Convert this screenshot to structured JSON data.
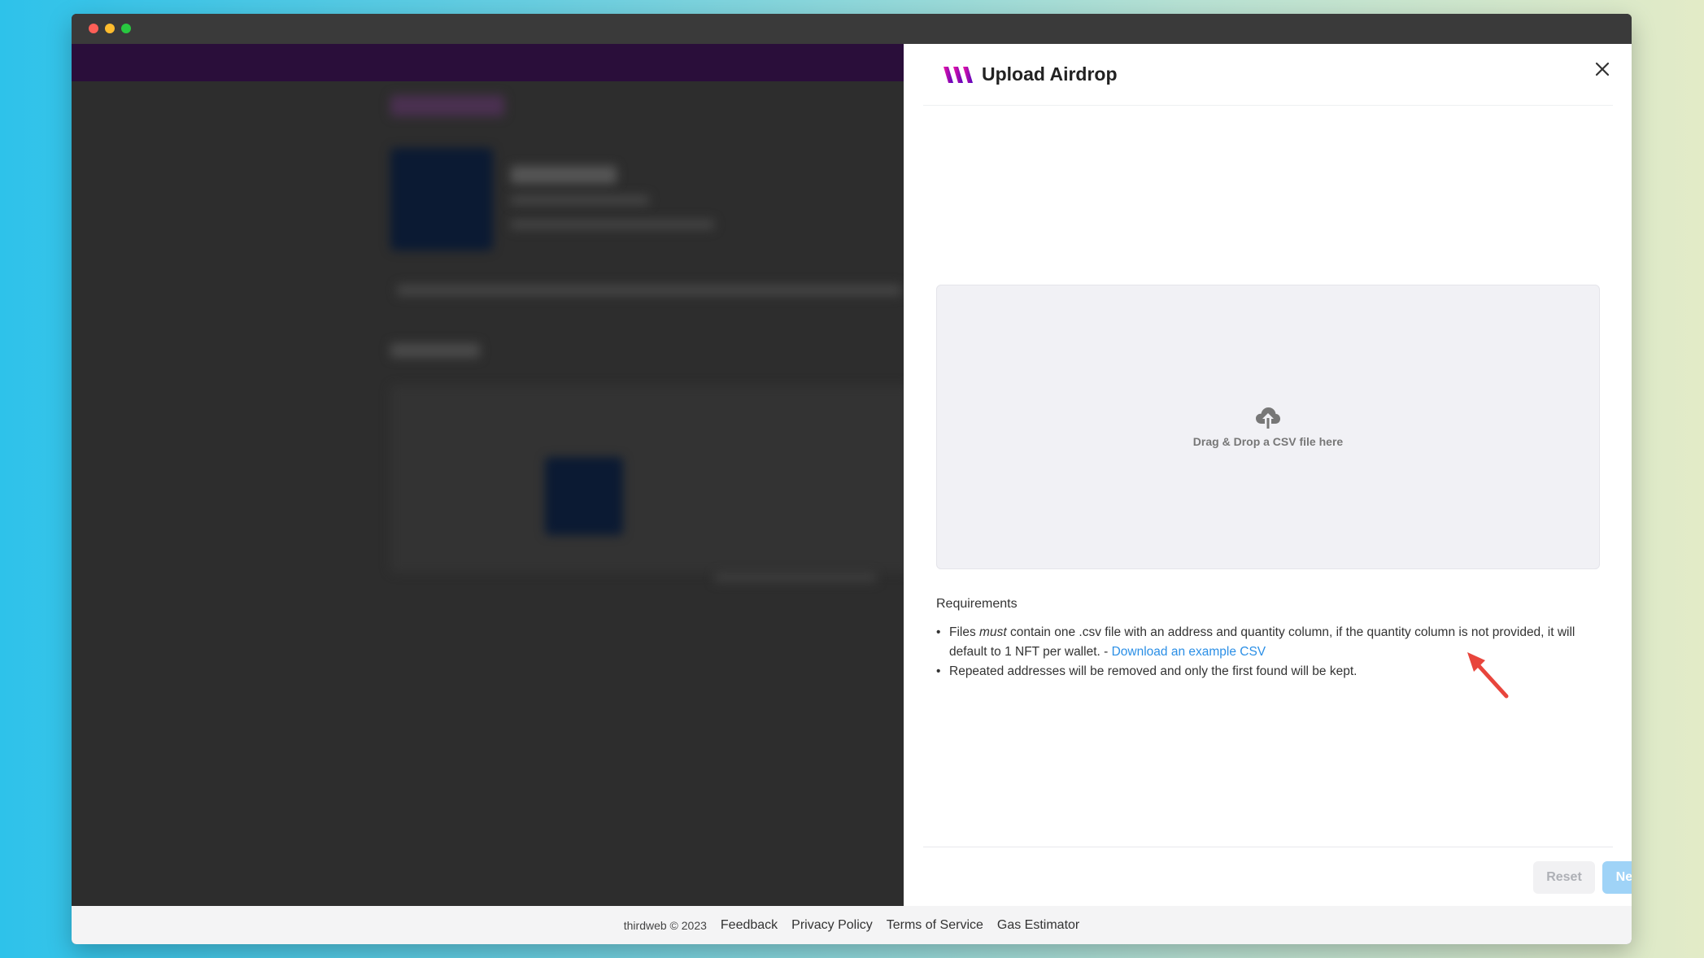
{
  "drawer": {
    "title": "Upload Airdrop",
    "dropzone_text": "Drag & Drop a CSV file here",
    "requirements_title": "Requirements",
    "req1_pre": "Files ",
    "req1_em": "must",
    "req1_post": " contain one .csv file with an address and quantity column, if the quantity column is not provided, it will default to 1 NFT per wallet. - ",
    "req1_link": "Download an example CSV",
    "req2": "Repeated addresses will be removed and only the first found will be kept.",
    "reset_label": "Reset",
    "next_label": "Next"
  },
  "footer": {
    "copyright": "thirdweb © 2023",
    "links": [
      "Feedback",
      "Privacy Policy",
      "Terms of Service",
      "Gas Estimator"
    ]
  },
  "colors": {
    "accent_link": "#2b8fe6",
    "next_button": "#9fd3f7",
    "annotation_arrow": "#e8453c",
    "logo_gradient_start": "#f213a4",
    "logo_gradient_end": "#5204bf"
  }
}
